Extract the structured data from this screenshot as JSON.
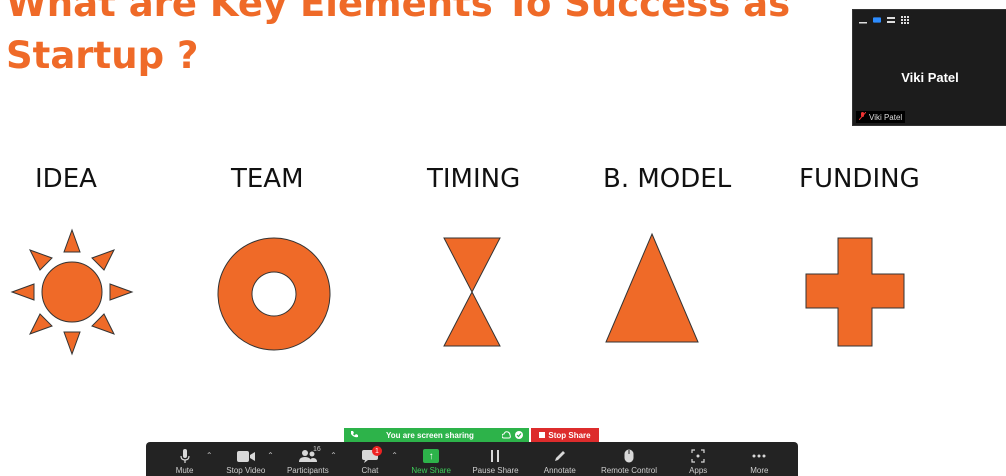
{
  "slide": {
    "title_line1": "What are Key Elements To Success as",
    "title_line2": "Startup  ?",
    "elements": [
      {
        "label": "IDEA",
        "shape": "sun-icon"
      },
      {
        "label": "TEAM",
        "shape": "ring-icon"
      },
      {
        "label": "TIMING",
        "shape": "hourglass-icon"
      },
      {
        "label": "B. MODEL",
        "shape": "triangle-icon"
      },
      {
        "label": "FUNDING",
        "shape": "cross-icon"
      }
    ],
    "accent_color": "#ef6a28"
  },
  "video_tile": {
    "name": "Viki Patel",
    "footer_name": "Viki Patel"
  },
  "share_bar": {
    "status": "You are screen sharing",
    "stop_label": "Stop Share"
  },
  "toolbar": {
    "mute": "Mute",
    "stop_video": "Stop Video",
    "participants": "Participants",
    "participants_count": "16",
    "chat": "Chat",
    "chat_unread": "1",
    "new_share": "New Share",
    "pause_share": "Pause Share",
    "annotate": "Annotate",
    "remote_control": "Remote Control",
    "apps": "Apps",
    "more": "More"
  }
}
